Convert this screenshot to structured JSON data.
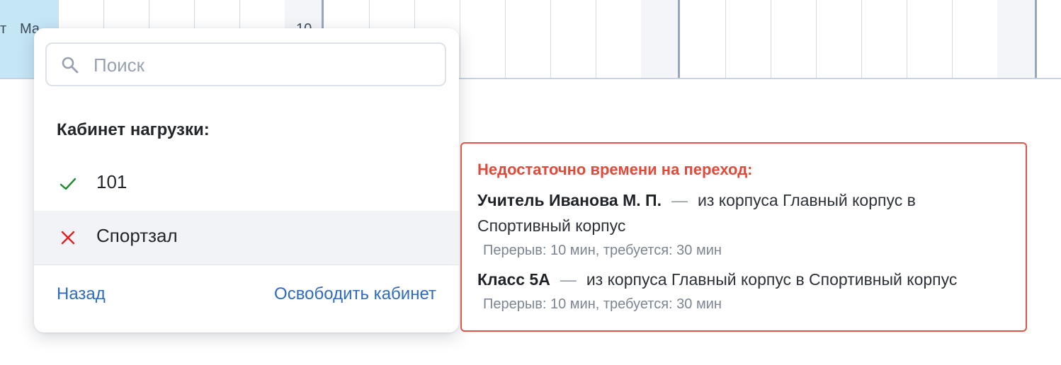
{
  "grid": {
    "header_labels": [
      "т",
      "Ма",
      "10"
    ]
  },
  "popover": {
    "search": {
      "placeholder": "Поиск",
      "value": ""
    },
    "section_title": "Кабинет нагрузки:",
    "items": [
      {
        "label": "101",
        "status_icon": "check-icon",
        "color": "#1a8a2a"
      },
      {
        "label": "Спортзал",
        "status_icon": "cross-icon",
        "color": "#e02020"
      }
    ],
    "back_label": "Назад",
    "free_label": "Освободить кабинет"
  },
  "warning": {
    "title": "Недостаточно времени на переход:",
    "entries": [
      {
        "subject": "Учитель Иванова М. П.",
        "dash": "—",
        "text_line1": "из корпуса Главный корпус в",
        "text_line2": "Спортивный корпус",
        "detail": "Перерыв: 10 мин, требуется: 30 мин"
      },
      {
        "subject": "Класс 5А",
        "dash": "—",
        "text_line1": "из корпуса Главный корпус в Спортивный корпус",
        "detail": "Перерыв: 10 мин, требуется: 30 мин"
      }
    ],
    "accent_color": "#e04a3b"
  }
}
